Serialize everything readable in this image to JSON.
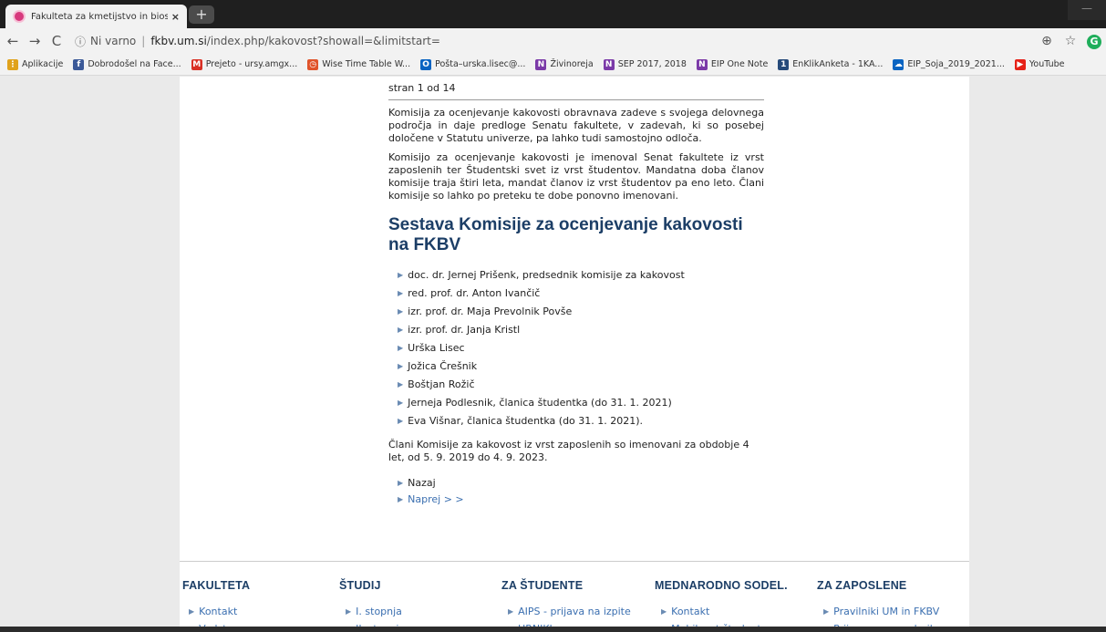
{
  "browser": {
    "tab_title": "Fakulteta za kmetijstvo in biosiste",
    "tab_close": "×",
    "new_tab": "+",
    "back": "←",
    "forward": "→",
    "reload": "C",
    "info": "ⓘ",
    "security_label": "Ni varno",
    "separator": "|",
    "url_host": "fkbv.um.si",
    "url_path": "/index.php/kakovost?showall=&limitstart=",
    "zoom_icon": "⊕",
    "star_icon": "☆",
    "ext_icon": "G"
  },
  "bookmarks": [
    {
      "label": "Aplikacije",
      "icon": "apps-icon",
      "color": "#e0a21c",
      "glyph": "⋮"
    },
    {
      "label": "Dobrodošel na Face...",
      "icon": "facebook-icon",
      "color": "#3b5998",
      "glyph": "f"
    },
    {
      "label": "Prejeto - ursy.amgx...",
      "icon": "gmail-icon",
      "color": "#d93025",
      "glyph": "M"
    },
    {
      "label": "Wise Time Table W...",
      "icon": "clock-icon",
      "color": "#e0532a",
      "glyph": "◷"
    },
    {
      "label": "Pošta–urska.lisec@...",
      "icon": "outlook-icon",
      "color": "#0a64c2",
      "glyph": "O"
    },
    {
      "label": "Živinoreja",
      "icon": "onenote-icon",
      "color": "#7b3aa8",
      "glyph": "N"
    },
    {
      "label": "SEP 2017, 2018",
      "icon": "onenote-icon",
      "color": "#7b3aa8",
      "glyph": "N"
    },
    {
      "label": "EIP One Note",
      "icon": "onenote-icon",
      "color": "#7b3aa8",
      "glyph": "N"
    },
    {
      "label": "EnKlikAnketa - 1KA...",
      "icon": "1ka-icon",
      "color": "#264a7a",
      "glyph": "1"
    },
    {
      "label": "EIP_Soja_2019_2021...",
      "icon": "onedrive-icon",
      "color": "#0a64c2",
      "glyph": "☁"
    },
    {
      "label": "YouTube",
      "icon": "youtube-icon",
      "color": "#e62117",
      "glyph": "▶"
    }
  ],
  "page": {
    "page_count": "stran 1 od 14",
    "para1": "Komisija za ocenjevanje kakovosti obravnava zadeve s svojega delovnega področja in daje predloge Senatu fakultete, v zadevah, ki so posebej določene v Statutu univerze, pa lahko tudi samostojno odloča.",
    "para2": "Komisijo za ocenjevanje kakovosti je imenoval Senat fakultete iz vrst zaposlenih ter Študentski svet iz vrst študentov. Mandatna doba članov komisije traja štiri leta, mandat članov iz vrst študentov pa eno leto. Člani komisije so lahko po preteku te dobe ponovno imenovani.",
    "heading": "Sestava Komisije za ocenjevanje kakovosti na FKBV",
    "members": [
      "doc. dr. Jernej Prišenk, predsednik komisije za kakovost",
      "red. prof. dr. Anton Ivančič",
      "izr. prof. dr. Maja Prevolnik Povše",
      "izr. prof. dr. Janja Kristl",
      "Urška Lisec",
      "Jožica Črešnik",
      "Boštjan Rožič",
      "Jerneja Podlesnik, članica študentka (do 31. 1. 2021)",
      "Eva Višnar, članica študentka (do 31. 1. 2021)."
    ],
    "para3": "Člani Komisije za kakovost iz vrst zaposlenih so imenovani za obdobje 4 let, od 5. 9. 2019 do 4. 9. 2023.",
    "nav_prev": "Nazaj",
    "nav_next": "Naprej > >"
  },
  "footer": [
    {
      "title": "FAKULTETA",
      "links": [
        "Kontakt",
        "Vodstvo"
      ]
    },
    {
      "title": "ŠTUDIJ",
      "links": [
        "I. stopnja",
        "II. stopnja"
      ]
    },
    {
      "title": "ZA ŠTUDENTE",
      "links": [
        "AIPS - prijava na izpite",
        "URNIKI"
      ]
    },
    {
      "title": "MEDNARODNO SODEL.",
      "links": [
        "Kontakt",
        "Mobilnost študentov"
      ]
    },
    {
      "title": "ZA ZAPOSLENE",
      "links": [
        "Pravilniki UM in FKBV",
        "Prijava za uporabnike"
      ]
    }
  ]
}
